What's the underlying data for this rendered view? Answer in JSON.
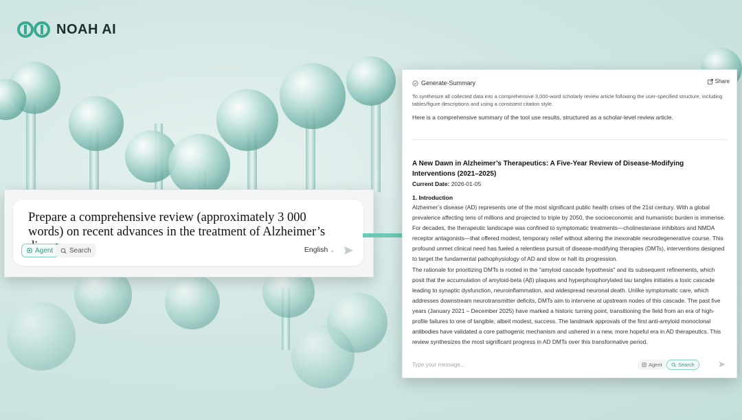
{
  "brand": {
    "name": "NOAH AI"
  },
  "prompt": {
    "text": "Prepare a comprehensive review (approximately 3 000 words) on recent advances in the treatment of Alzheimer’s disease.",
    "agent_label": "Agent",
    "search_label": "Search",
    "language": "English"
  },
  "panel": {
    "header_title": "Generate-Summary",
    "share_label": "Share",
    "subtitle": "To synthesize all collected data into a comprehensive 3,000-word scholarly review article following the user-specified structure, including tables/figure descriptions and using a consistent citation style.",
    "intro": "Here is a comprehensive summary of the tool use results, structured as a scholar-level review article.",
    "article_title": "A New Dawn in Alzheimer’s Therapeutics: A Five-Year Review of Disease-Modifying Interventions (2021–2025)",
    "date_label": "Current Date:",
    "date_value": "2026-01-05",
    "section_heading": "1. Introduction",
    "paragraph_1": "Alzheimer’s disease (AD) represents one of the most significant public health crises of the 21st century. With a global prevalence affecting tens of millions and projected to triple by 2050, the socioeconomic and humanistic burden is immense. For decades, the therapeutic landscape was confined to symptomatic treatments—cholinesterase inhibitors and NMDA receptor antagonists—that offered modest, temporary relief without altering the inexorable neurodegenerative course. This profound unmet clinical need has fueled a relentless pursuit of disease-modifying therapies (DMTs), interventions designed to target the fundamental pathophysiology of AD and slow or halt its progression.",
    "paragraph_2": "The rationale for prioritizing DMTs is rooted in the \"amyloid cascade hypothesis\" and its subsequent refinements, which posit that the accumulation of amyloid-beta (Aβ) plaques and hyperphosphorylated tau tangles initiates a toxic cascade leading to synaptic dysfunction, neuroinflammation, and widespread neuronal death. Unlike symptomatic care, which addresses downstream neurotransmitter deficits, DMTs aim to intervene at upstream nodes of this cascade. The past five years (January 2021 – December 2025) have marked a historic turning point, transitioning the field from an era of high-profile failures to one of tangible, albeit modest, success. The landmark approvals of the first anti-amyloid monoclonal antibodies have validated a core pathogenic mechanism and ushered in a new, more hopeful era in AD therapeutics. This review synthesizes the most significant progress in AD DMTs over this transformative period.",
    "input_placeholder": "Type your message...",
    "agent_label": "Agent",
    "search_label": "Search"
  },
  "colors": {
    "accent": "#5cc2ad",
    "arrow": "#6cc9b4",
    "logo": "#3aa991"
  }
}
